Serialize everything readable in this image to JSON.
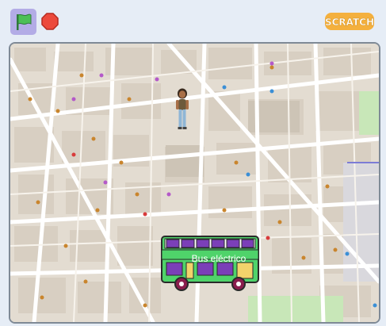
{
  "toolbar": {
    "green_flag_icon": "green-flag-icon",
    "stop_icon": "stop-sign-icon",
    "logo_text": "SCRATCH"
  },
  "stage": {
    "bus_sprite": {
      "label": "Bus eléctrico",
      "body_color": "#4fd36a",
      "window_color": "#7b3fb8"
    },
    "person_sprite": {
      "name": "person"
    }
  },
  "colors": {
    "flag_active_bg": "#b3ace6",
    "stop_red": "#ec4a3c",
    "logo_orange": "#f4b03e",
    "stage_border": "#7f8a96"
  }
}
